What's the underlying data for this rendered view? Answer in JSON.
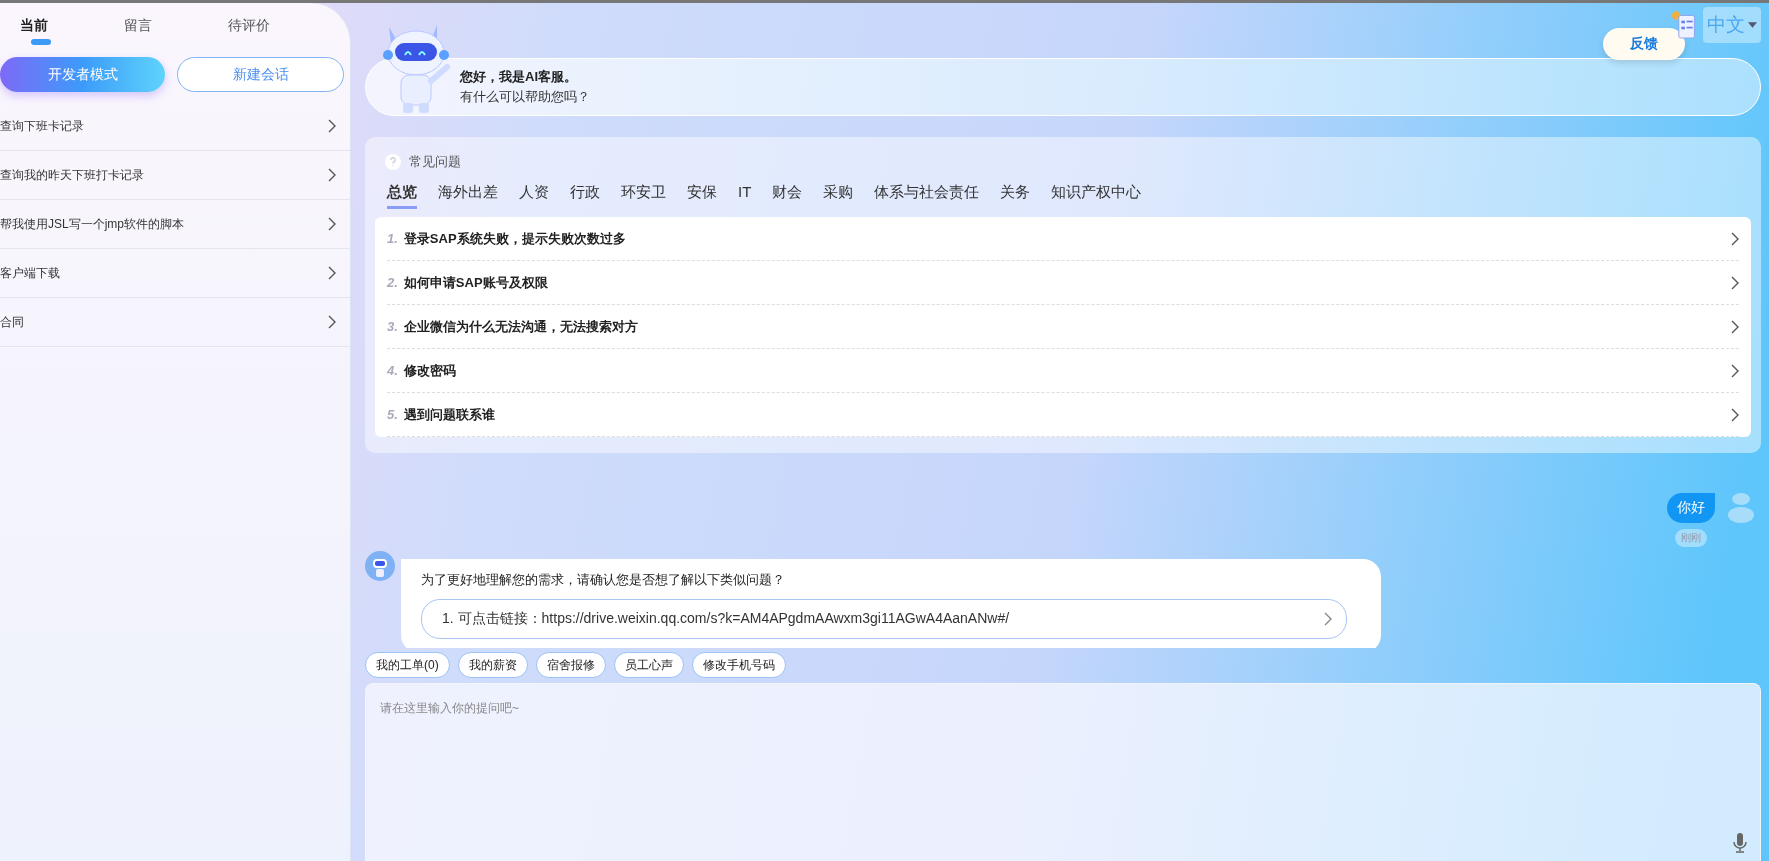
{
  "sidebar": {
    "tabs": [
      {
        "label": "当前",
        "selected": true
      },
      {
        "label": "留言",
        "selected": false
      },
      {
        "label": "待评价",
        "selected": false
      }
    ],
    "buttons": [
      {
        "label": "开发者模式",
        "kind": "primary"
      },
      {
        "label": "新建会话",
        "kind": "outline"
      }
    ],
    "items": [
      "查询下班卡记录",
      "查询我的昨天下班打卡记录",
      "帮我使用JSL写一个jmp软件的脚本",
      "客户端下载",
      "合同"
    ]
  },
  "header": {
    "greeting": "您好，我是AI客服。",
    "subtitle": "有什么可以帮助您吗？",
    "feedback": "反馈",
    "language": "中文"
  },
  "faq": {
    "title": "常见问题",
    "tabs": [
      {
        "label": "总览",
        "selected": true
      },
      {
        "label": "海外出差",
        "selected": false
      },
      {
        "label": "人资",
        "selected": false
      },
      {
        "label": "行政",
        "selected": false
      },
      {
        "label": "环安卫",
        "selected": false
      },
      {
        "label": "安保",
        "selected": false
      },
      {
        "label": "IT",
        "selected": false
      },
      {
        "label": "财会",
        "selected": false
      },
      {
        "label": "采购",
        "selected": false
      },
      {
        "label": "体系与社会责任",
        "selected": false
      },
      {
        "label": "关务",
        "selected": false
      },
      {
        "label": "知识产权中心",
        "selected": false
      }
    ],
    "questions": [
      {
        "number": "1.",
        "text": "登录SAP系统失败，提示失败次数过多"
      },
      {
        "number": "2.",
        "text": "如何申请SAP账号及权限"
      },
      {
        "number": "3.",
        "text": "企业微信为什么无法沟通，无法搜索对方"
      },
      {
        "number": "4.",
        "text": "修改密码"
      },
      {
        "number": "5.",
        "text": "遇到问题联系谁"
      }
    ]
  },
  "chat": {
    "messages": [
      {
        "kind": "user",
        "text": "你好",
        "time": "刚刚"
      },
      {
        "kind": "bot",
        "text": "为了更好地理解您的需求，请确认您是否想了解以下类似问题？",
        "options": [
          "1. 可点击链接：https://drive.weixin.qq.com/s?k=AM4APgdmAAwxm3gi11AGwA4AanANw#/"
        ]
      }
    ]
  },
  "quick_replies": [
    "我的工单(0)",
    "我的薪资",
    "宿舍报修",
    "员工心声",
    "修改手机号码"
  ],
  "input": {
    "placeholder": "请在这里输入你的提问吧~"
  }
}
